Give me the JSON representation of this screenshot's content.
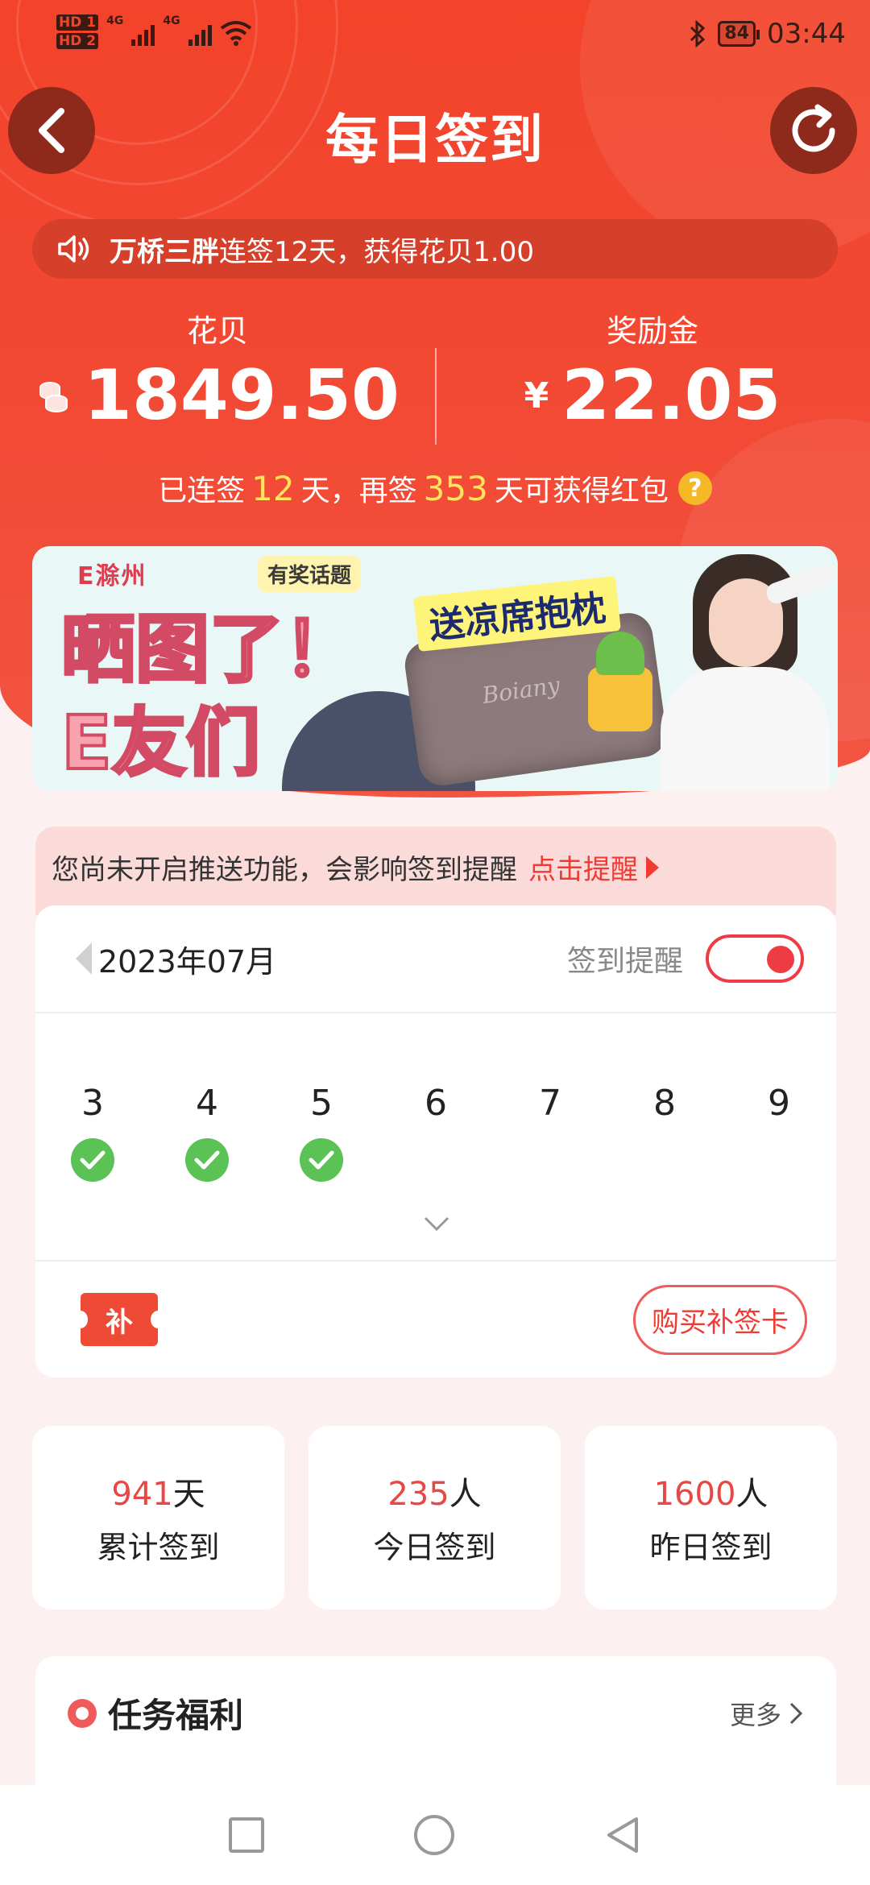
{
  "status_bar": {
    "hd1": "HD 1",
    "hd2": "HD 2",
    "net1": "4G",
    "net2": "4G",
    "battery": "84",
    "time": "03:44"
  },
  "header": {
    "title": "每日签到"
  },
  "ticker": {
    "user": "万桥三胖",
    "message": "连签12天，获得花贝1.00"
  },
  "balances": {
    "huabei_label": "花贝",
    "huabei_value": "1849.50",
    "reward_label": "奖励金",
    "reward_currency": "¥",
    "reward_value": "22.05"
  },
  "streak": {
    "prefix": "已连签",
    "days": "12",
    "mid": "天，再签",
    "remaining": "353",
    "suffix": "天可获得红包",
    "help_icon": "?"
  },
  "banner": {
    "logo": "E滁州",
    "tag": "有奖话题",
    "line1": "晒图了！",
    "line2": "E友们",
    "promo": "送凉席抱枕",
    "pillow_brand": "Boiany"
  },
  "notice": {
    "text": "您尚未开启推送功能，会影响签到提醒",
    "action": "点击提醒"
  },
  "calendar": {
    "month": "2023年07月",
    "remind_label": "签到提醒",
    "remind_on": true,
    "days": [
      {
        "num": "3",
        "checked": true
      },
      {
        "num": "4",
        "checked": true
      },
      {
        "num": "5",
        "checked": true
      },
      {
        "num": "6",
        "checked": false
      },
      {
        "num": "7",
        "checked": false
      },
      {
        "num": "8",
        "checked": false
      },
      {
        "num": "9",
        "checked": false
      }
    ],
    "makeup_ticket": "补",
    "buy_button": "购买补签卡"
  },
  "summary": [
    {
      "value": "941",
      "unit": "天",
      "label": "累计签到"
    },
    {
      "value": "235",
      "unit": "人",
      "label": "今日签到"
    },
    {
      "value": "1600",
      "unit": "人",
      "label": "昨日签到"
    }
  ],
  "tasks": {
    "title": "任务福利",
    "more": "更多"
  },
  "colors": {
    "primary_red": "#f3432a",
    "accent_red": "#ef3b33",
    "highlight_yellow": "#ffe45c",
    "check_green": "#5bc256"
  }
}
